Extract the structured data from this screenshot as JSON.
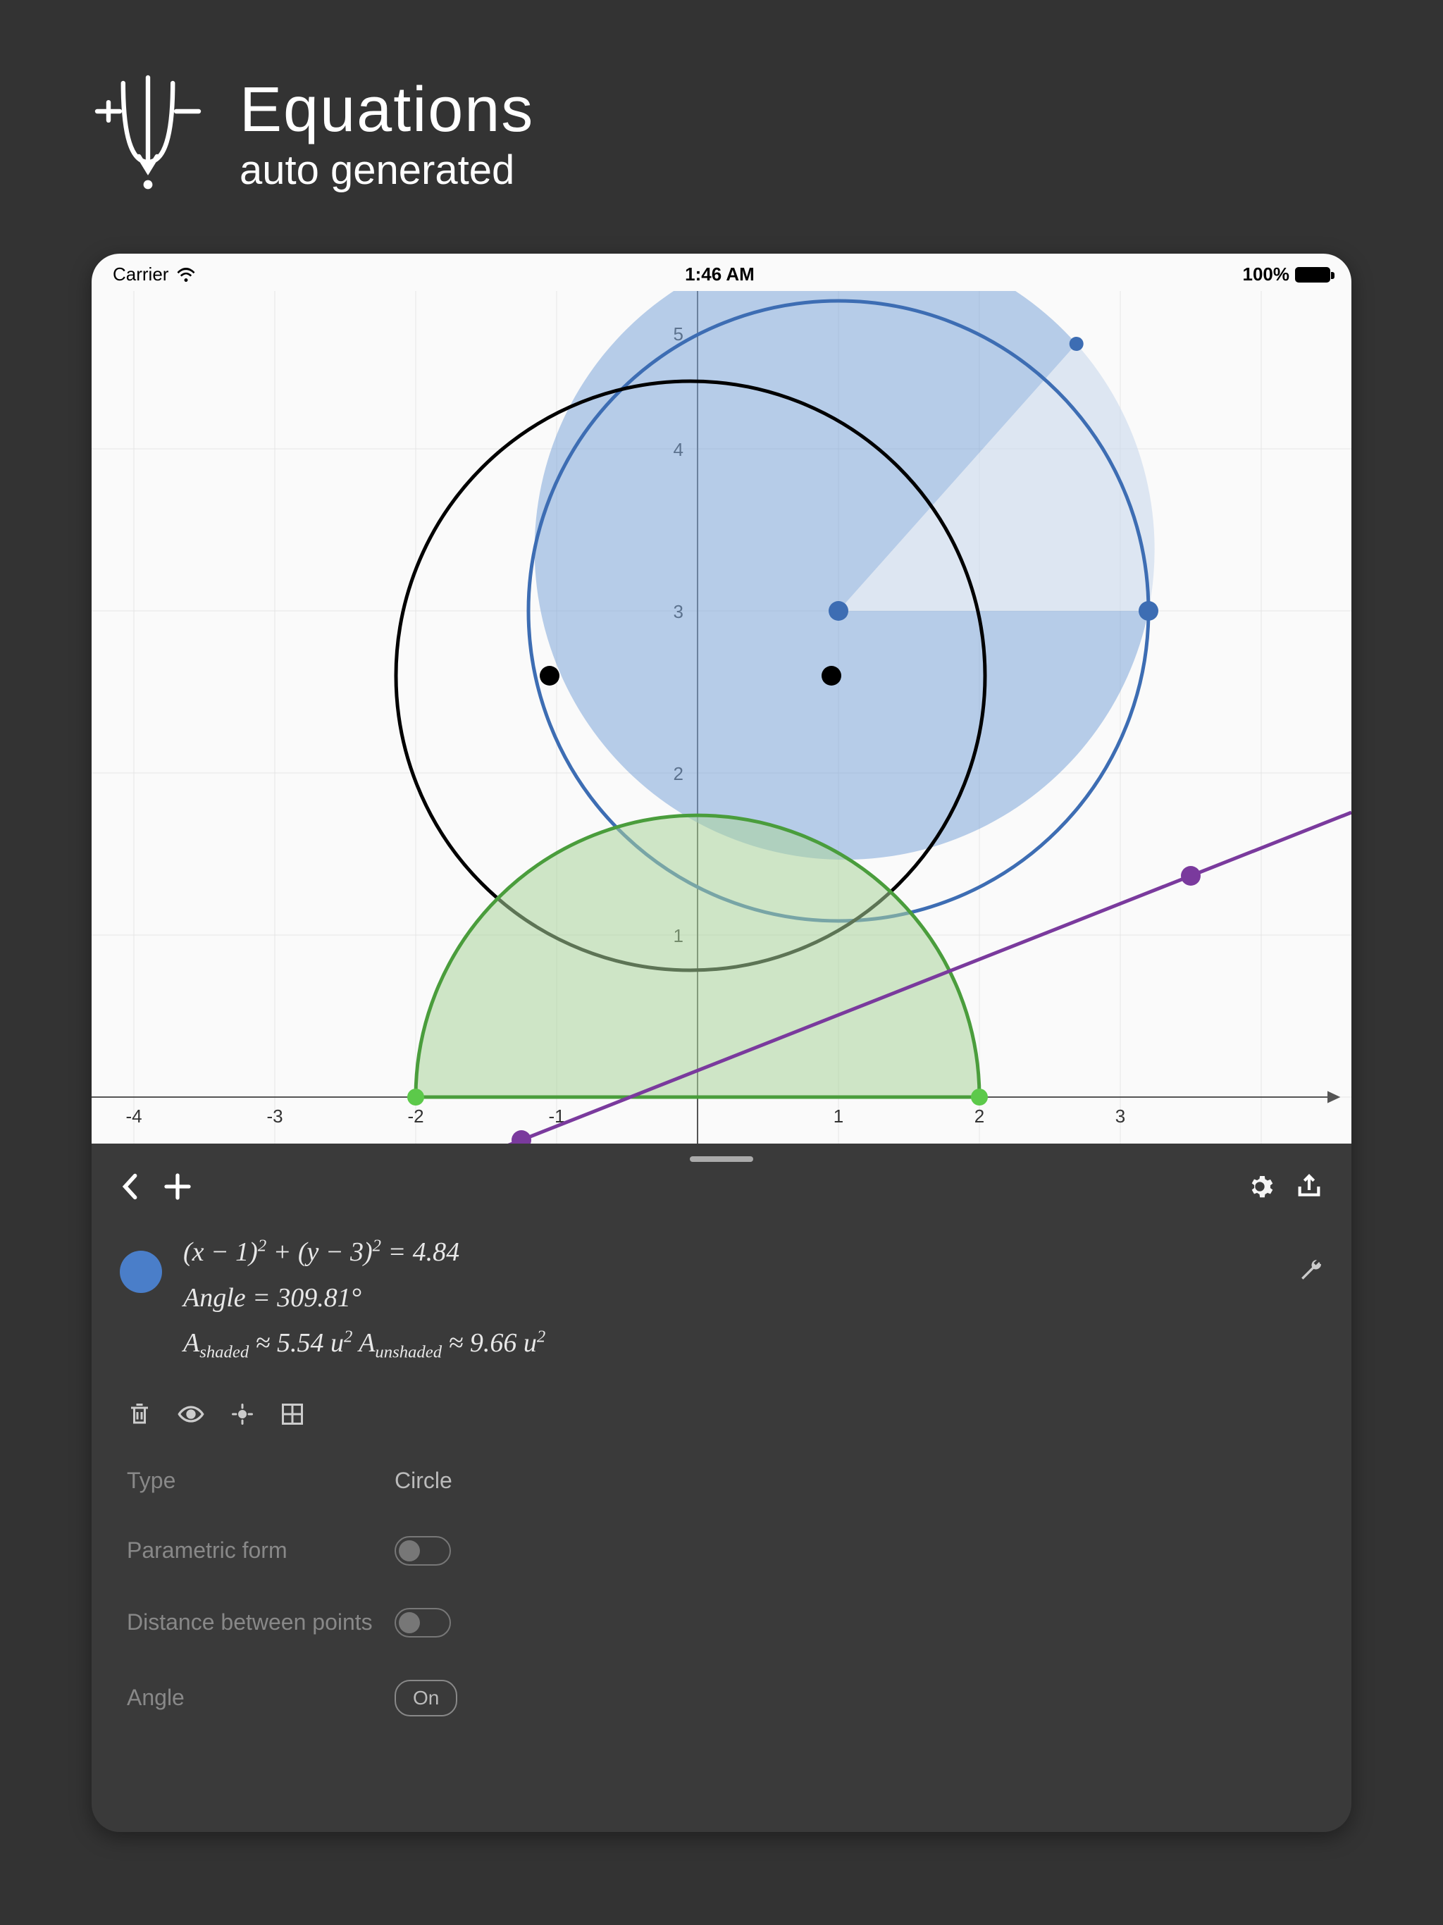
{
  "header": {
    "title": "Equations",
    "subtitle": "auto generated"
  },
  "statusBar": {
    "carrier": "Carrier",
    "time": "1:46 AM",
    "battery": "100%"
  },
  "graph": {
    "xTicks": [
      "-4",
      "-3",
      "-2",
      "-1",
      "1",
      "2",
      "3"
    ],
    "yTicks": [
      "1",
      "2",
      "3",
      "4",
      "5"
    ]
  },
  "panel": {
    "equation": {
      "line1": "(x − 1)² + (y − 3)² = 4.84",
      "angleLabel": "Angle",
      "angleValue": "309.81",
      "angleSuffix": "°",
      "shadedLabel": "A",
      "shadedSub": "shaded",
      "shadedApprox": "≈ 5.54 u²",
      "unshadedSub": "unshaded",
      "unshadedApprox": "≈ 9.66 u²",
      "color": "#4a7ec9"
    },
    "settings": {
      "typeLabel": "Type",
      "typeValue": "Circle",
      "parametricLabel": "Parametric form",
      "distanceLabel": "Distance between points",
      "angleLabel": "Angle",
      "angleValue": "On"
    }
  }
}
